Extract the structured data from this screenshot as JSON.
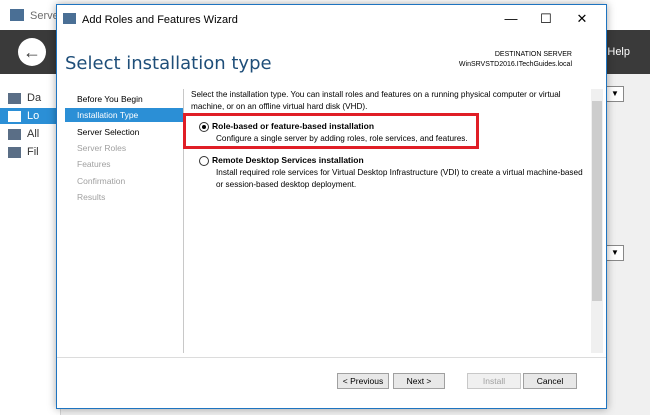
{
  "background": {
    "title": "Serve",
    "help_label": "Help",
    "sidebar": [
      {
        "label": "Da",
        "active": false
      },
      {
        "label": "Lo",
        "active": true
      },
      {
        "label": "All",
        "active": false
      },
      {
        "label": "Fil",
        "active": false
      }
    ],
    "back_icon": "back-arrow-icon"
  },
  "wizard": {
    "title": "Add Roles and Features Wizard",
    "window_controls": {
      "minimize": "—",
      "maximize": "☐",
      "close": "✕"
    },
    "page_title": "Select installation type",
    "destination": {
      "label": "DESTINATION SERVER",
      "value": "WinSRVSTD2016.ITechGuides.local"
    },
    "nav": [
      {
        "label": "Before You Begin",
        "state": "normal"
      },
      {
        "label": "Installation Type",
        "state": "active"
      },
      {
        "label": "Server Selection",
        "state": "normal"
      },
      {
        "label": "Server Roles",
        "state": "disabled"
      },
      {
        "label": "Features",
        "state": "disabled"
      },
      {
        "label": "Confirmation",
        "state": "disabled"
      },
      {
        "label": "Results",
        "state": "disabled"
      }
    ],
    "intro": "Select the installation type. You can install roles and features on a running physical computer or virtual machine, or on an offline virtual hard disk (VHD).",
    "options": [
      {
        "title": "Role-based or feature-based installation",
        "description": "Configure a single server by adding roles, role services, and features.",
        "selected": true
      },
      {
        "title": "Remote Desktop Services installation",
        "description": "Install required role services for Virtual Desktop Infrastructure (VDI) to create a virtual machine-based or session-based desktop deployment.",
        "selected": false
      }
    ],
    "buttons": {
      "previous": "< Previous",
      "next": "Next >",
      "install": "Install",
      "cancel": "Cancel"
    },
    "highlight_color": "#e01e26",
    "accent_color": "#2b8fd6"
  }
}
